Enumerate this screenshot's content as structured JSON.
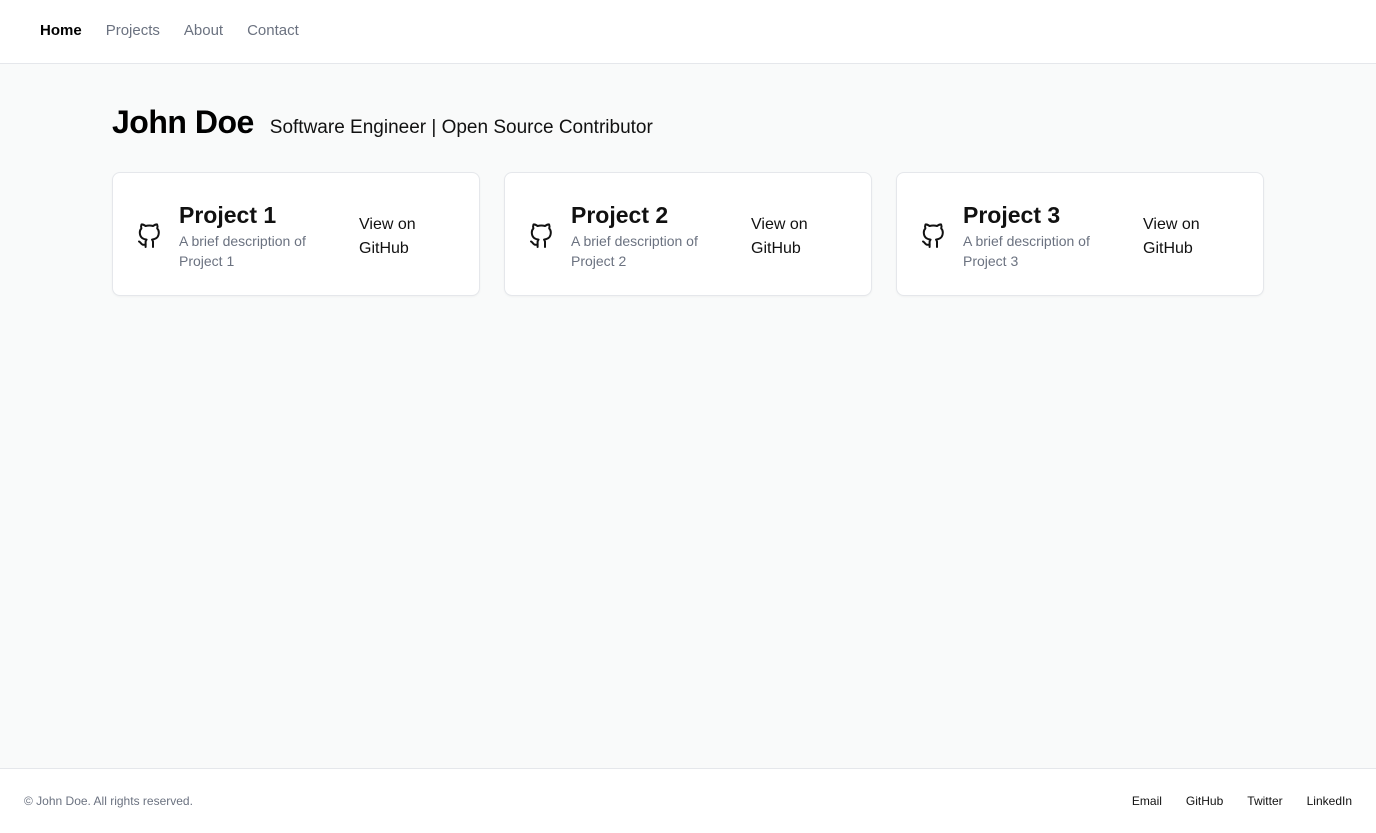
{
  "nav": {
    "items": [
      {
        "label": "Home",
        "active": true
      },
      {
        "label": "Projects",
        "active": false
      },
      {
        "label": "About",
        "active": false
      },
      {
        "label": "Contact",
        "active": false
      }
    ]
  },
  "hero": {
    "name": "John Doe",
    "tagline": "Software Engineer | Open Source Contributor"
  },
  "projects": [
    {
      "icon": "github-icon",
      "title": "Project 1",
      "description": "A brief description of Project 1",
      "link_label": "View on GitHub"
    },
    {
      "icon": "github-icon",
      "title": "Project 2",
      "description": "A brief description of Project 2",
      "link_label": "View on GitHub"
    },
    {
      "icon": "github-icon",
      "title": "Project 3",
      "description": "A brief description of Project 3",
      "link_label": "View on GitHub"
    }
  ],
  "footer": {
    "copyright": "© John Doe. All rights reserved.",
    "links": [
      "Email",
      "GitHub",
      "Twitter",
      "LinkedIn"
    ]
  },
  "colors": {
    "page_background": "#f9fafa",
    "surface": "#ffffff",
    "border": "#e5e7eb",
    "muted_text": "#6b7280",
    "primary_text": "#111111"
  }
}
